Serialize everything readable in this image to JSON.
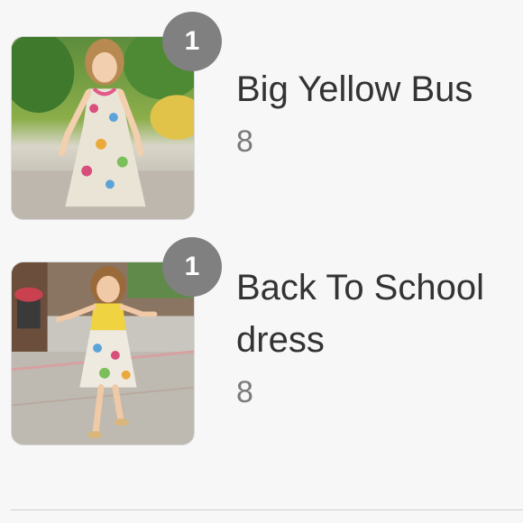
{
  "boards": [
    {
      "title": "Big Yellow Bus",
      "count": "8",
      "badge": "1",
      "thumbnail_icon": "photo-girl-floral-dress"
    },
    {
      "title": "Back To School dress",
      "count": "8",
      "badge": "1",
      "thumbnail_icon": "photo-girl-yellow-dress"
    }
  ],
  "colors": {
    "background": "#f7f7f7",
    "badge": "#808080",
    "title": "#333333",
    "count": "#7a7a7a"
  }
}
